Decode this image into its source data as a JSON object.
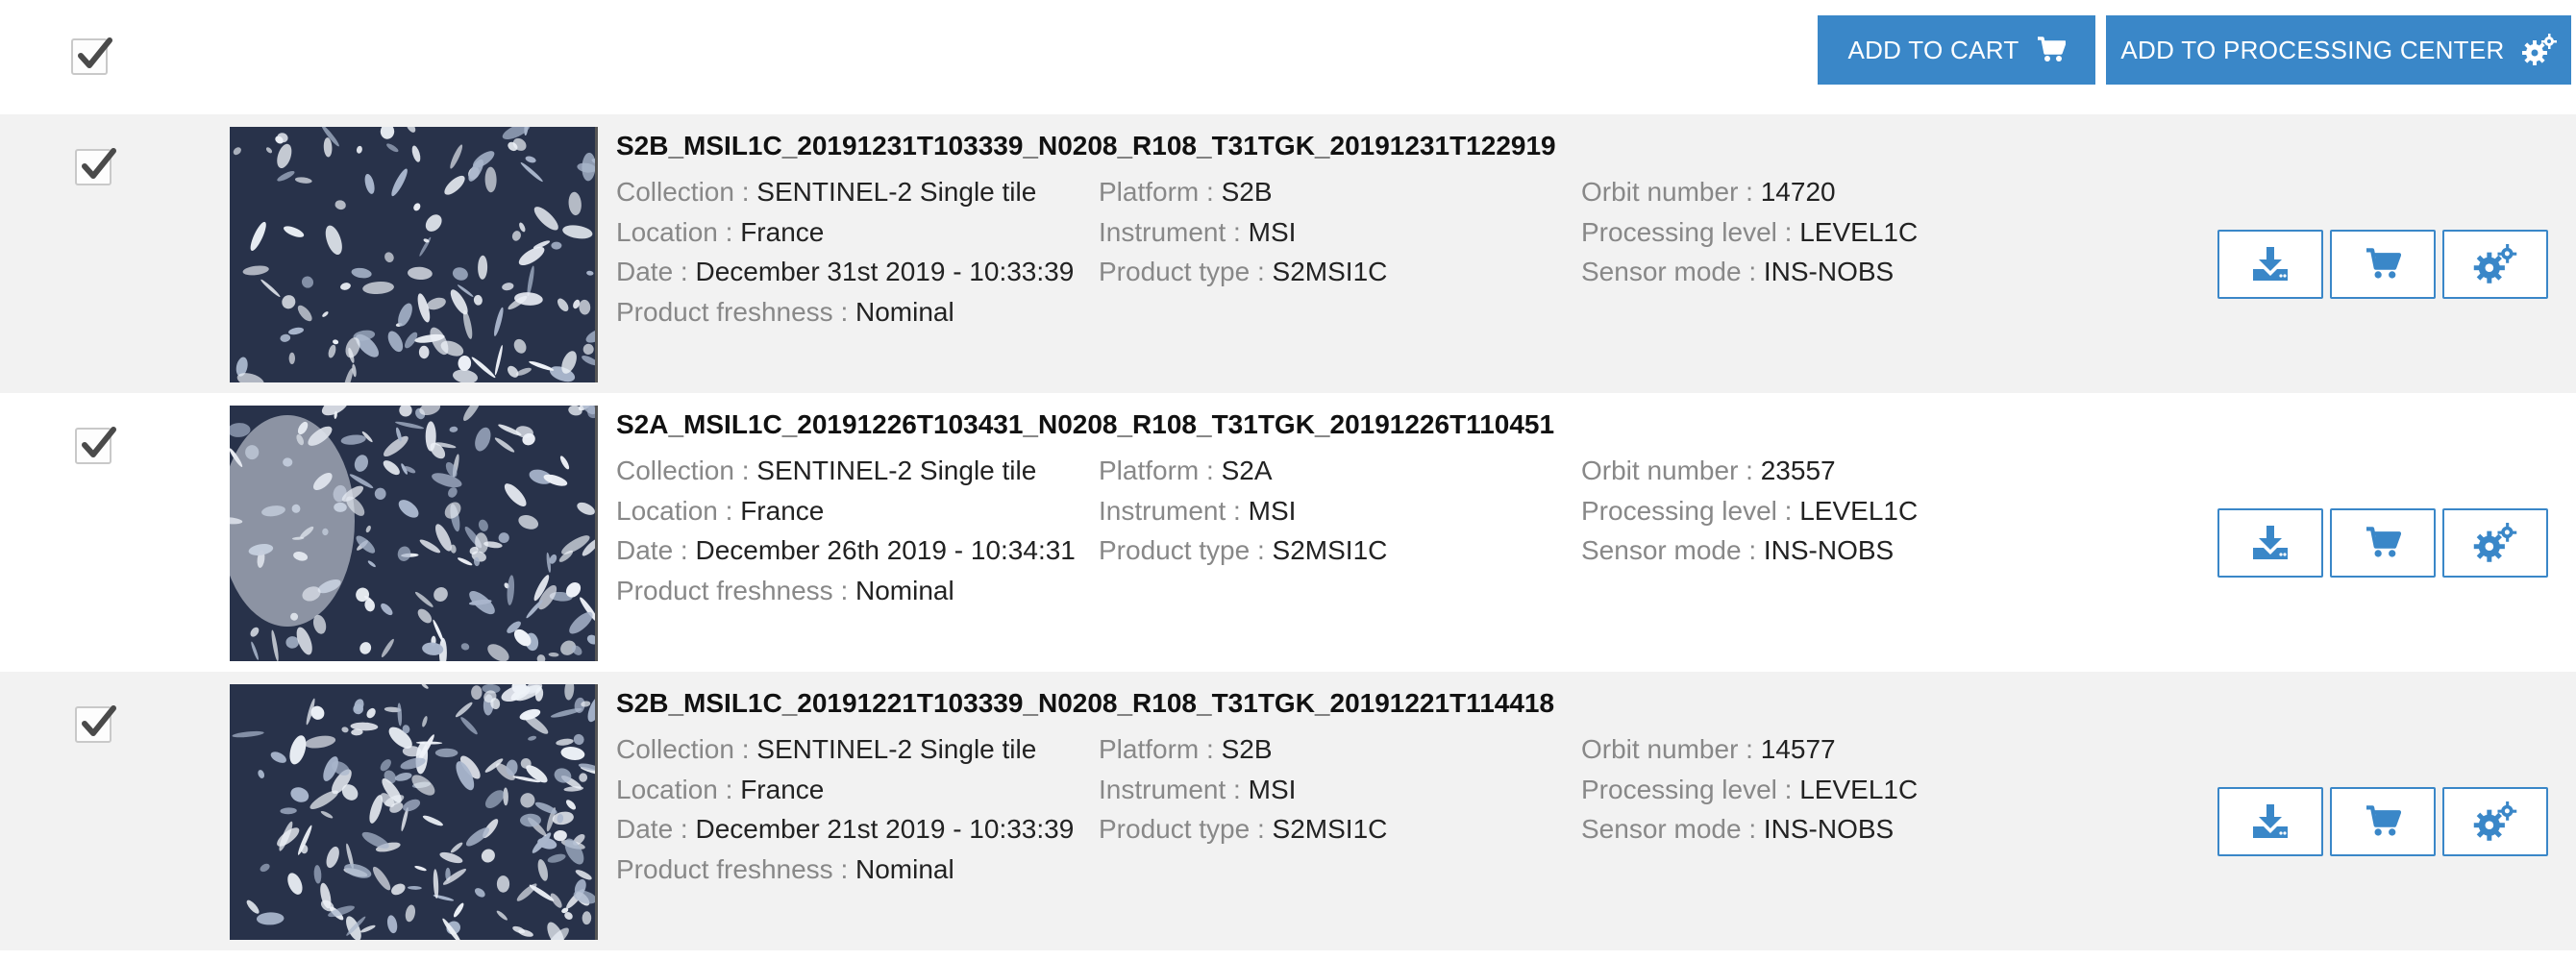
{
  "toolbar": {
    "add_to_cart_label": "ADD TO CART",
    "add_to_processing_label": "ADD TO PROCESSING CENTER",
    "select_all_checked": true
  },
  "labels": {
    "collection": "Collection : ",
    "location": "Location : ",
    "date": "Date : ",
    "freshness": "Product freshness : ",
    "platform": "Platform : ",
    "instrument": "Instrument : ",
    "product_type": "Product type : ",
    "orbit": "Orbit number : ",
    "processing_level": "Processing level : ",
    "sensor_mode": "Sensor mode : "
  },
  "products": [
    {
      "title": "S2B_MSIL1C_20191231T103339_N0208_R108_T31TGK_20191231T122919",
      "checked": true,
      "collection": "SENTINEL-2 Single tile",
      "location": "France",
      "date": "December 31st 2019 - 10:33:39",
      "freshness": "Nominal",
      "platform": "S2B",
      "instrument": "MSI",
      "product_type": "S2MSI1C",
      "orbit": "14720",
      "processing_level": "LEVEL1C",
      "sensor_mode": "INS-NOBS"
    },
    {
      "title": "S2A_MSIL1C_20191226T103431_N0208_R108_T31TGK_20191226T110451",
      "checked": true,
      "collection": "SENTINEL-2 Single tile",
      "location": "France",
      "date": "December 26th 2019 - 10:34:31",
      "freshness": "Nominal",
      "platform": "S2A",
      "instrument": "MSI",
      "product_type": "S2MSI1C",
      "orbit": "23557",
      "processing_level": "LEVEL1C",
      "sensor_mode": "INS-NOBS"
    },
    {
      "title": "S2B_MSIL1C_20191221T103339_N0208_R108_T31TGK_20191221T114418",
      "checked": true,
      "collection": "SENTINEL-2 Single tile",
      "location": "France",
      "date": "December 21st 2019 - 10:33:39",
      "freshness": "Nominal",
      "platform": "S2B",
      "instrument": "MSI",
      "product_type": "S2MSI1C",
      "orbit": "14577",
      "processing_level": "LEVEL1C",
      "sensor_mode": "INS-NOBS"
    }
  ],
  "icons": {
    "cart": "cart-icon",
    "cogs": "cogs-icon",
    "download": "download-icon",
    "check": "check-icon"
  },
  "colors": {
    "accent": "#3a87c8",
    "row_shade": "#f2f2f2",
    "label_gray": "#888888"
  }
}
